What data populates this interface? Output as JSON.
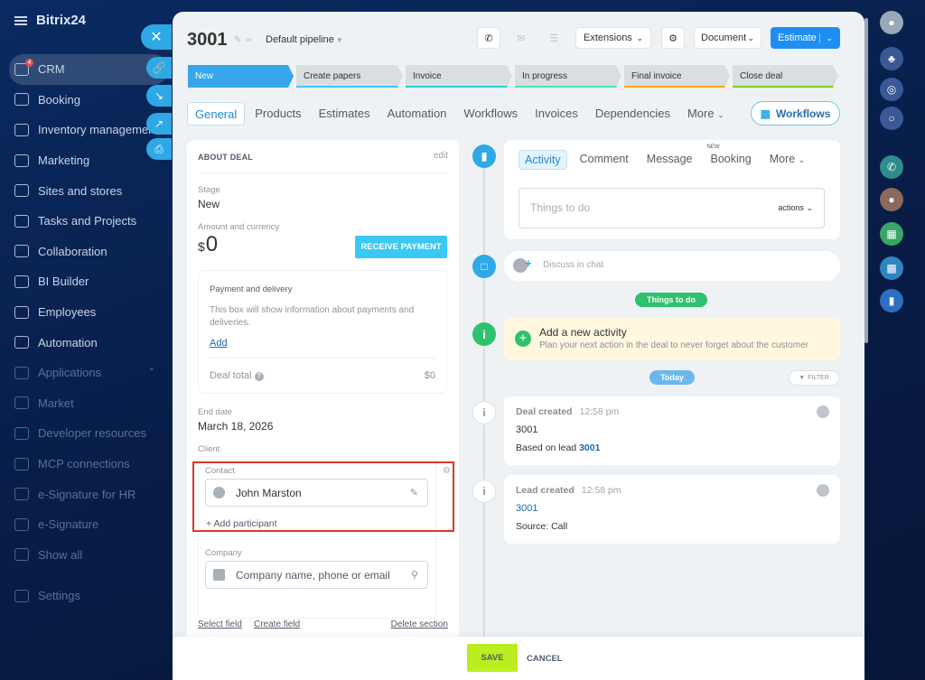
{
  "app": {
    "brand": "Bitrix24",
    "brand_mark": "®"
  },
  "sidebar": {
    "items": [
      {
        "label": "CRM",
        "badge": "4"
      },
      {
        "label": "Booking"
      },
      {
        "label": "Inventory management"
      },
      {
        "label": "Marketing"
      },
      {
        "label": "Sites and stores"
      },
      {
        "label": "Tasks and Projects"
      },
      {
        "label": "Collaboration"
      },
      {
        "label": "BI Builder"
      },
      {
        "label": "Employees"
      },
      {
        "label": "Automation"
      },
      {
        "label": "Applications"
      },
      {
        "label": "Market"
      },
      {
        "label": "Developer resources"
      },
      {
        "label": "MCP connections"
      },
      {
        "label": "e-Signature for HR"
      },
      {
        "label": "e-Signature"
      },
      {
        "label": "Show all"
      },
      {
        "label": "Settings"
      }
    ]
  },
  "deal": {
    "title": "3001",
    "pipeline": "Default pipeline",
    "header_buttons": {
      "extensions": "Extensions",
      "document": "Document",
      "estimate": "Estimate"
    },
    "stages": [
      "New",
      "Create papers",
      "Invoice",
      "In progress",
      "Final invoice",
      "Close deal"
    ],
    "tabs": [
      "General",
      "Products",
      "Estimates",
      "Automation",
      "Workflows",
      "Invoices",
      "Dependencies",
      "More"
    ],
    "workflows_button": "Workflows"
  },
  "about": {
    "title": "ABOUT DEAL",
    "edit": "edit",
    "stage_label": "Stage",
    "stage_value": "New",
    "amount_label": "Amount and currency",
    "currency": "$",
    "amount": "0",
    "receive_payment": "RECEIVE PAYMENT",
    "payment_title": "Payment and delivery",
    "payment_text": "This box will show information about payments and deliveries.",
    "add": "Add",
    "deal_total_label": "Deal total",
    "deal_total_value": "$0",
    "end_date_label": "End date",
    "end_date_value": "March 18, 2026",
    "client_label": "Client",
    "contact_label": "Contact",
    "contact_value": "John Marston",
    "add_participant": "+ Add participant",
    "company_label": "Company",
    "company_placeholder": "Company name, phone or email",
    "select_field": "Select field",
    "create_field": "Create field",
    "delete_section": "Delete section"
  },
  "activity": {
    "tabs": [
      "Activity",
      "Comment",
      "Message",
      "Booking",
      "More"
    ],
    "booking_badge": "NEW",
    "todo_placeholder": "Things to do",
    "actions": "actions",
    "discuss": "Discuss in chat",
    "things_to_do_pill": "Things to do",
    "add_activity_title": "Add a new activity",
    "add_activity_text": "Plan your next action in the deal to never forget about the customer",
    "today": "Today",
    "filter": "FILTER"
  },
  "history": [
    {
      "title": "Deal created",
      "time": "12:58 pm",
      "line1": "3001",
      "line2_prefix": "Based on lead",
      "line2_link": "3001"
    },
    {
      "title": "Lead created",
      "time": "12:58 pm",
      "line1": "3001",
      "line2_prefix": "Source: Call",
      "line2_link": ""
    }
  ],
  "footer": {
    "save": "SAVE",
    "cancel": "CANCEL"
  },
  "colors": {
    "accent": "#1f8ef1",
    "save": "#bbed21",
    "highlight": "#d9382d",
    "green": "#2fc26e"
  }
}
